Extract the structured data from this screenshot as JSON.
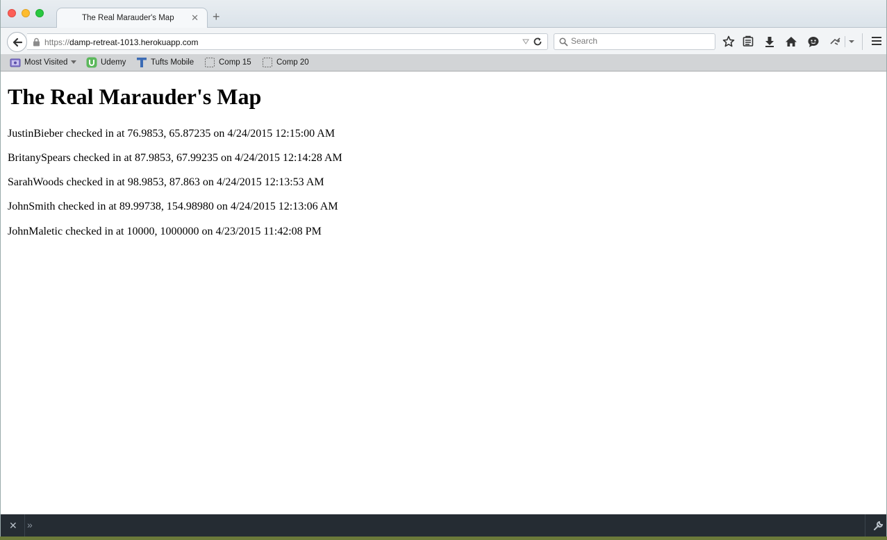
{
  "tab": {
    "title": "The Real Marauder's Map"
  },
  "navbar": {
    "url_protocol": "https://",
    "url_host": "damp-retreat-1013.herokuapp.com",
    "search_placeholder": "Search"
  },
  "bookmarks": [
    {
      "label": "Most Visited",
      "icon": "most-visited-icon"
    },
    {
      "label": "Udemy",
      "icon": "udemy-icon"
    },
    {
      "label": "Tufts Mobile",
      "icon": "tufts-icon"
    },
    {
      "label": "Comp 15",
      "icon": "folder-dashed-icon"
    },
    {
      "label": "Comp 20",
      "icon": "folder-dashed-icon"
    }
  ],
  "page": {
    "title": "The Real Marauder's Map",
    "entries": [
      "JustinBieber checked in at 76.9853, 65.87235 on 4/24/2015 12:15:00 AM",
      "BritanySpears checked in at 87.9853, 67.99235 on 4/24/2015 12:14:28 AM",
      "SarahWoods checked in at 98.9853, 87.863 on 4/24/2015 12:13:53 AM",
      "JohnSmith checked in at 89.99738, 154.98980 on 4/24/2015 12:13:06 AM",
      "JohnMaletic checked in at 10000, 1000000 on 4/23/2015 11:42:08 PM"
    ]
  },
  "colors": {
    "close": "#fc5f57",
    "minimize": "#fdbc2e",
    "maximize": "#28c840",
    "devtools_bar": "#252c33"
  }
}
